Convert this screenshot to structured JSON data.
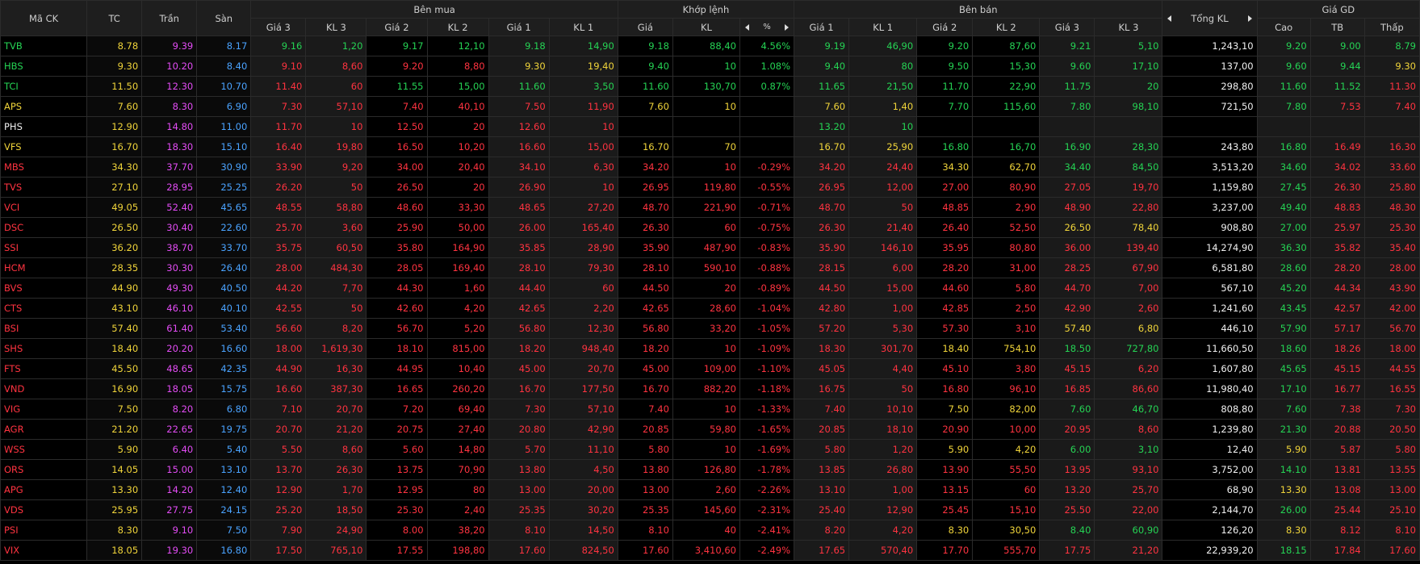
{
  "header": {
    "col_symbol": "Mã CK",
    "col_ref": "TC",
    "col_ceil": "Trần",
    "col_floor": "Sàn",
    "group_buy": "Bên mua",
    "group_match": "Khớp lệnh",
    "group_sell": "Bên bán",
    "group_total": "Tổng KL",
    "group_price": "Giá GD",
    "sub_buy": [
      "Giá 3",
      "KL 3",
      "Giá 2",
      "KL 2",
      "Giá 1",
      "KL 1"
    ],
    "sub_match_price": "Giá",
    "sub_match_vol": "KL",
    "sub_match_pct": "%",
    "sub_sell": [
      "Giá 1",
      "KL 1",
      "Giá 2",
      "KL 2",
      "Giá 3",
      "KL 3"
    ],
    "sub_price": [
      "Cao",
      "TB",
      "Thấp"
    ]
  },
  "colors": {
    "up": "#25d354",
    "down": "#ff3340",
    "ref": "#f0d43a",
    "ceil": "#e34cf5",
    "floor": "#4aa3ff",
    "none": "#f0f0f0"
  },
  "rows": [
    [
      "TVB",
      "8.78",
      "9.39",
      "8.17",
      "9.16",
      "1,20",
      "9.17",
      "12,10",
      "9.18",
      "14,90",
      "9.18",
      "88,40",
      "4.56%",
      "9.19",
      "46,90",
      "9.20",
      "87,60",
      "9.21",
      "5,10",
      "1,243,10",
      "9.20",
      "9.00",
      "8.79"
    ],
    [
      "HBS",
      "9.30",
      "10.20",
      "8.40",
      "9.10",
      "8,60",
      "9.20",
      "8,80",
      "9.30",
      "19,40",
      "9.40",
      "10",
      "1.08%",
      "9.40",
      "80",
      "9.50",
      "15,30",
      "9.60",
      "17,10",
      "137,00",
      "9.60",
      "9.44",
      "9.30"
    ],
    [
      "TCI",
      "11.50",
      "12.30",
      "10.70",
      "11.40",
      "60",
      "11.55",
      "15,00",
      "11.60",
      "3,50",
      "11.60",
      "130,70",
      "0.87%",
      "11.65",
      "21,50",
      "11.70",
      "22,90",
      "11.75",
      "20",
      "298,80",
      "11.60",
      "11.52",
      "11.30"
    ],
    [
      "APS",
      "7.60",
      "8.30",
      "6.90",
      "7.30",
      "57,10",
      "7.40",
      "40,10",
      "7.50",
      "11,90",
      "7.60",
      "10",
      "",
      "7.60",
      "1,40",
      "7.70",
      "115,60",
      "7.80",
      "98,10",
      "721,50",
      "7.80",
      "7.53",
      "7.40"
    ],
    [
      "PHS",
      "12.90",
      "14.80",
      "11.00",
      "11.70",
      "10",
      "12.50",
      "20",
      "12.60",
      "10",
      "",
      "",
      "",
      "13.20",
      "10",
      "",
      "",
      "",
      "",
      "",
      "",
      "",
      ""
    ],
    [
      "VFS",
      "16.70",
      "18.30",
      "15.10",
      "16.40",
      "19,80",
      "16.50",
      "10,20",
      "16.60",
      "15,00",
      "16.70",
      "70",
      "",
      "16.70",
      "25,90",
      "16.80",
      "16,70",
      "16.90",
      "28,30",
      "243,80",
      "16.80",
      "16.49",
      "16.30"
    ],
    [
      "MBS",
      "34.30",
      "37.70",
      "30.90",
      "33.90",
      "9,20",
      "34.00",
      "20,40",
      "34.10",
      "6,30",
      "34.20",
      "10",
      "-0.29%",
      "34.20",
      "24,40",
      "34.30",
      "62,70",
      "34.40",
      "84,50",
      "3,513,20",
      "34.60",
      "34.02",
      "33.60"
    ],
    [
      "TVS",
      "27.10",
      "28.95",
      "25.25",
      "26.20",
      "50",
      "26.50",
      "20",
      "26.90",
      "10",
      "26.95",
      "119,80",
      "-0.55%",
      "26.95",
      "12,00",
      "27.00",
      "80,90",
      "27.05",
      "19,70",
      "1,159,80",
      "27.45",
      "26.30",
      "25.80"
    ],
    [
      "VCI",
      "49.05",
      "52.40",
      "45.65",
      "48.55",
      "58,80",
      "48.60",
      "33,30",
      "48.65",
      "27,20",
      "48.70",
      "221,90",
      "-0.71%",
      "48.70",
      "50",
      "48.85",
      "2,90",
      "48.90",
      "22,80",
      "3,237,00",
      "49.40",
      "48.83",
      "48.30"
    ],
    [
      "DSC",
      "26.50",
      "30.40",
      "22.60",
      "25.70",
      "3,60",
      "25.90",
      "50,00",
      "26.00",
      "165,40",
      "26.30",
      "60",
      "-0.75%",
      "26.30",
      "21,40",
      "26.40",
      "52,50",
      "26.50",
      "78,40",
      "908,80",
      "27.00",
      "25.97",
      "25.30"
    ],
    [
      "SSI",
      "36.20",
      "38.70",
      "33.70",
      "35.75",
      "60,50",
      "35.80",
      "164,90",
      "35.85",
      "28,90",
      "35.90",
      "487,90",
      "-0.83%",
      "35.90",
      "146,10",
      "35.95",
      "80,80",
      "36.00",
      "139,40",
      "14,274,90",
      "36.30",
      "35.82",
      "35.40"
    ],
    [
      "HCM",
      "28.35",
      "30.30",
      "26.40",
      "28.00",
      "484,30",
      "28.05",
      "169,40",
      "28.10",
      "79,30",
      "28.10",
      "590,10",
      "-0.88%",
      "28.15",
      "6,00",
      "28.20",
      "31,00",
      "28.25",
      "67,90",
      "6,581,80",
      "28.60",
      "28.20",
      "28.00"
    ],
    [
      "BVS",
      "44.90",
      "49.30",
      "40.50",
      "44.20",
      "7,70",
      "44.30",
      "1,60",
      "44.40",
      "60",
      "44.50",
      "20",
      "-0.89%",
      "44.50",
      "15,00",
      "44.60",
      "5,80",
      "44.70",
      "7,00",
      "567,10",
      "45.20",
      "44.34",
      "43.90"
    ],
    [
      "CTS",
      "43.10",
      "46.10",
      "40.10",
      "42.55",
      "50",
      "42.60",
      "4,20",
      "42.65",
      "2,20",
      "42.65",
      "28,60",
      "-1.04%",
      "42.80",
      "1,00",
      "42.85",
      "2,50",
      "42.90",
      "2,60",
      "1,241,60",
      "43.45",
      "42.57",
      "42.00"
    ],
    [
      "BSI",
      "57.40",
      "61.40",
      "53.40",
      "56.60",
      "8,20",
      "56.70",
      "5,20",
      "56.80",
      "12,30",
      "56.80",
      "33,20",
      "-1.05%",
      "57.20",
      "5,30",
      "57.30",
      "3,10",
      "57.40",
      "6,80",
      "446,10",
      "57.90",
      "57.17",
      "56.70"
    ],
    [
      "SHS",
      "18.40",
      "20.20",
      "16.60",
      "18.00",
      "1,619,30",
      "18.10",
      "815,00",
      "18.20",
      "948,40",
      "18.20",
      "10",
      "-1.09%",
      "18.30",
      "301,70",
      "18.40",
      "754,10",
      "18.50",
      "727,80",
      "11,660,50",
      "18.60",
      "18.26",
      "18.00"
    ],
    [
      "FTS",
      "45.50",
      "48.65",
      "42.35",
      "44.90",
      "16,30",
      "44.95",
      "10,40",
      "45.00",
      "20,70",
      "45.00",
      "109,00",
      "-1.10%",
      "45.05",
      "4,40",
      "45.10",
      "3,80",
      "45.15",
      "6,20",
      "1,607,80",
      "45.65",
      "45.15",
      "44.55"
    ],
    [
      "VND",
      "16.90",
      "18.05",
      "15.75",
      "16.60",
      "387,30",
      "16.65",
      "260,20",
      "16.70",
      "177,50",
      "16.70",
      "882,20",
      "-1.18%",
      "16.75",
      "50",
      "16.80",
      "96,10",
      "16.85",
      "86,60",
      "11,980,40",
      "17.10",
      "16.77",
      "16.55"
    ],
    [
      "VIG",
      "7.50",
      "8.20",
      "6.80",
      "7.10",
      "20,70",
      "7.20",
      "69,40",
      "7.30",
      "57,10",
      "7.40",
      "10",
      "-1.33%",
      "7.40",
      "10,10",
      "7.50",
      "82,00",
      "7.60",
      "46,70",
      "808,80",
      "7.60",
      "7.38",
      "7.30"
    ],
    [
      "AGR",
      "21.20",
      "22.65",
      "19.75",
      "20.70",
      "21,20",
      "20.75",
      "27,40",
      "20.80",
      "42,90",
      "20.85",
      "59,80",
      "-1.65%",
      "20.85",
      "18,10",
      "20.90",
      "10,00",
      "20.95",
      "8,60",
      "1,239,80",
      "21.30",
      "20.88",
      "20.50"
    ],
    [
      "WSS",
      "5.90",
      "6.40",
      "5.40",
      "5.50",
      "8,60",
      "5.60",
      "14,80",
      "5.70",
      "11,10",
      "5.80",
      "10",
      "-1.69%",
      "5.80",
      "1,20",
      "5.90",
      "4,20",
      "6.00",
      "3,10",
      "12,40",
      "5.90",
      "5.87",
      "5.80"
    ],
    [
      "ORS",
      "14.05",
      "15.00",
      "13.10",
      "13.70",
      "26,30",
      "13.75",
      "70,90",
      "13.80",
      "4,50",
      "13.80",
      "126,80",
      "-1.78%",
      "13.85",
      "26,80",
      "13.90",
      "55,50",
      "13.95",
      "93,10",
      "3,752,00",
      "14.10",
      "13.81",
      "13.55"
    ],
    [
      "APG",
      "13.30",
      "14.20",
      "12.40",
      "12.90",
      "1,70",
      "12.95",
      "80",
      "13.00",
      "20,00",
      "13.00",
      "2,60",
      "-2.26%",
      "13.10",
      "1,00",
      "13.15",
      "60",
      "13.20",
      "25,70",
      "68,90",
      "13.30",
      "13.08",
      "13.00"
    ],
    [
      "VDS",
      "25.95",
      "27.75",
      "24.15",
      "25.20",
      "18,50",
      "25.30",
      "2,40",
      "25.35",
      "30,20",
      "25.35",
      "145,60",
      "-2.31%",
      "25.40",
      "12,90",
      "25.45",
      "15,10",
      "25.50",
      "22,00",
      "2,144,70",
      "26.00",
      "25.44",
      "25.10"
    ],
    [
      "PSI",
      "8.30",
      "9.10",
      "7.50",
      "7.90",
      "24,90",
      "8.00",
      "38,20",
      "8.10",
      "14,50",
      "8.10",
      "40",
      "-2.41%",
      "8.20",
      "4,20",
      "8.30",
      "30,50",
      "8.40",
      "60,90",
      "126,20",
      "8.30",
      "8.12",
      "8.10"
    ],
    [
      "VIX",
      "18.05",
      "19.30",
      "16.80",
      "17.50",
      "765,10",
      "17.55",
      "198,80",
      "17.60",
      "824,50",
      "17.60",
      "3,410,60",
      "-2.49%",
      "17.65",
      "570,40",
      "17.70",
      "555,70",
      "17.75",
      "21,20",
      "22,939,20",
      "18.15",
      "17.84",
      "17.60"
    ]
  ]
}
